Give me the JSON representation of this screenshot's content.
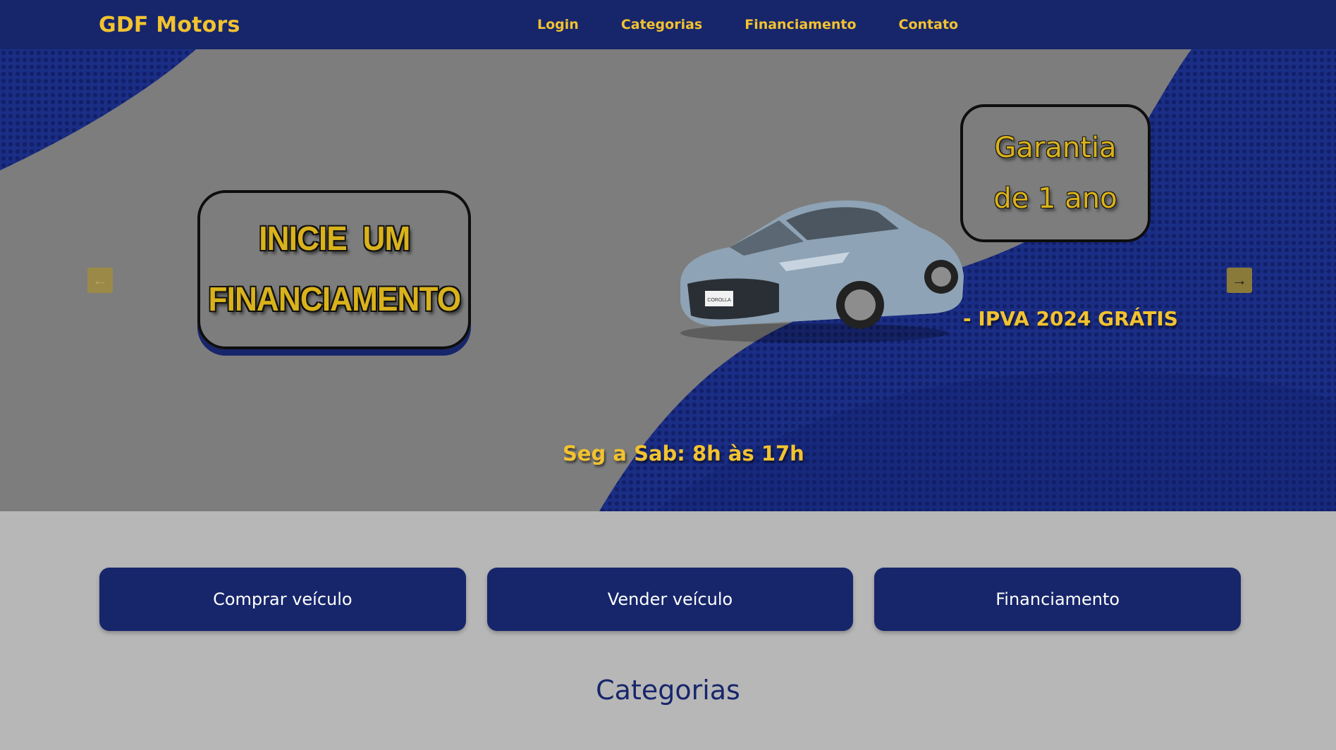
{
  "navbar": {
    "brand": "GDF Motors",
    "links": [
      "Login",
      "Categorias",
      "Financiamento",
      "Contato"
    ]
  },
  "hero": {
    "promo_left": [
      "INICIE  UM",
      "FINANCIAMENTO"
    ],
    "promo_right": [
      "Garantia",
      "de 1 ano"
    ],
    "ipva": "- IPVA 2024 GRÁTIS",
    "hours": "Seg a Sab: 8h às 17h",
    "car_plate": "COROLLA",
    "prev_icon": "arrow-left-icon",
    "next_icon": "arrow-right-icon"
  },
  "actions": [
    "Comprar veículo",
    "Vender veículo",
    "Financiamento"
  ],
  "section_title": "Categorias",
  "colors": {
    "navy": "#17266b",
    "gold": "#f2c230",
    "hero_gray": "#7d7d7d",
    "page_bg": "#b7b7b7"
  }
}
